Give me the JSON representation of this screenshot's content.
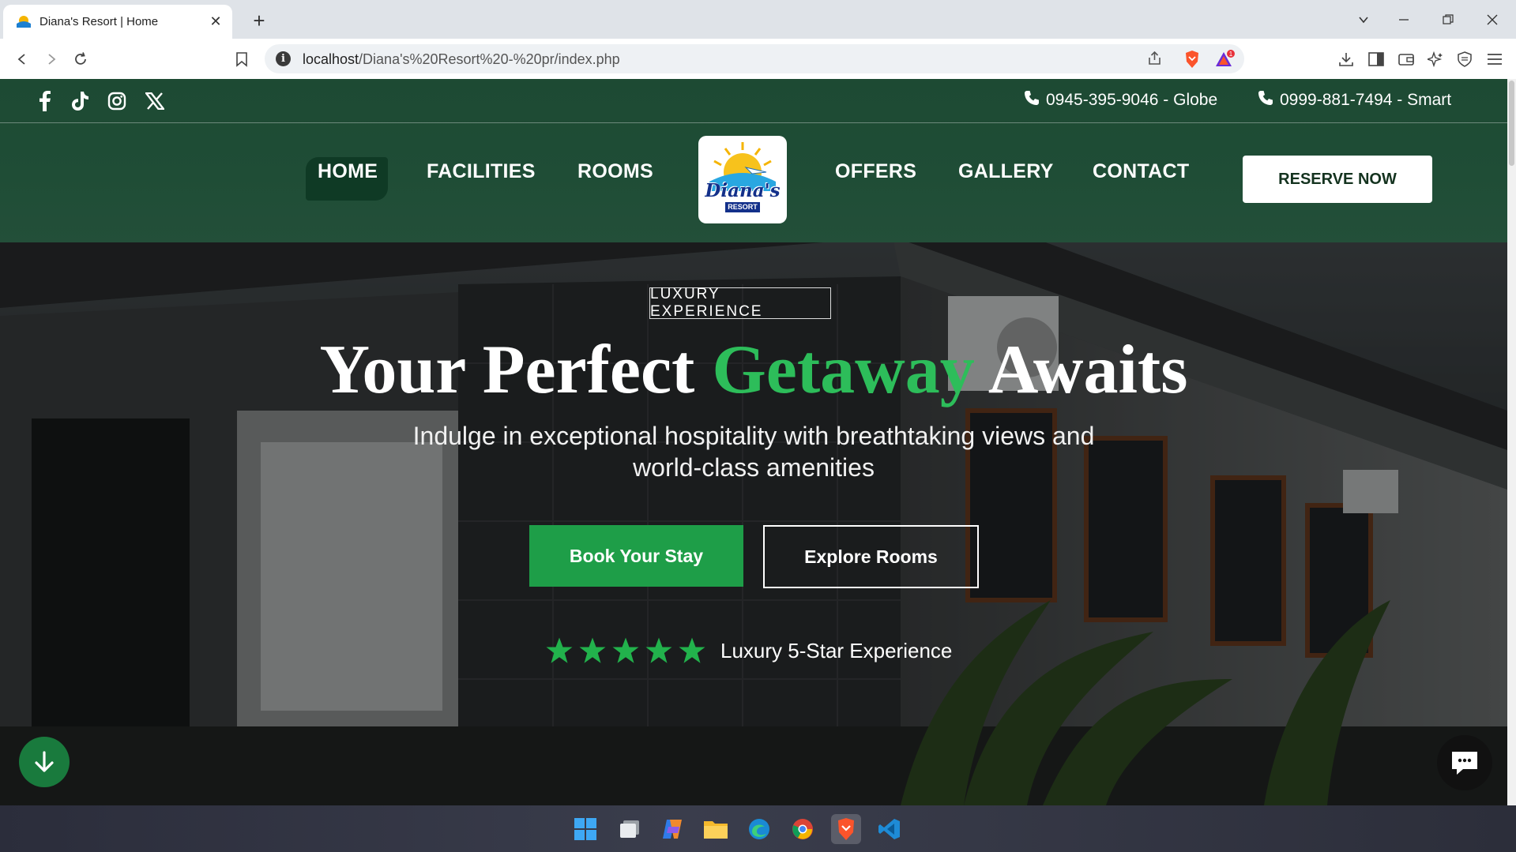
{
  "browser": {
    "tab_title": "Diana's Resort | Home",
    "url_host": "localhost",
    "url_path": "/Diana's%20Resort%20-%20pr/index.php",
    "brave_badge": "1"
  },
  "topbar": {
    "social": [
      "facebook",
      "tiktok",
      "instagram",
      "x"
    ],
    "phone_globe": "0945-395-9046 - Globe",
    "phone_smart": "0999-881-7494 - Smart"
  },
  "nav": {
    "home": "HOME",
    "facilities": "FACILITIES",
    "rooms": "ROOMS",
    "offers": "OFFERS",
    "gallery": "GALLERY",
    "contact": "CONTACT",
    "reserve": "RESERVE NOW"
  },
  "logo": {
    "line1": "Diana's",
    "line2": "RESORT"
  },
  "hero": {
    "tag": "LUXURY EXPERIENCE",
    "title_pre": "Your Perfect ",
    "title_accent": "Getaway",
    "title_post": " Awaits",
    "subtitle_line1": "Indulge in exceptional hospitality with breathtaking views and",
    "subtitle_line2": "world-class amenities",
    "book_button": "Book Your Stay",
    "explore_button": "Explore Rooms",
    "rating": 5,
    "rating_label": "Luxury 5-Star Experience"
  },
  "colors": {
    "accent_green": "#2dbd5a",
    "button_green": "#1e9e48",
    "header_green": "#1f4d36"
  },
  "taskbar": [
    "windows-start",
    "file-explorer-window",
    "copilot",
    "file-explorer",
    "edge",
    "chrome",
    "brave",
    "vscode"
  ]
}
